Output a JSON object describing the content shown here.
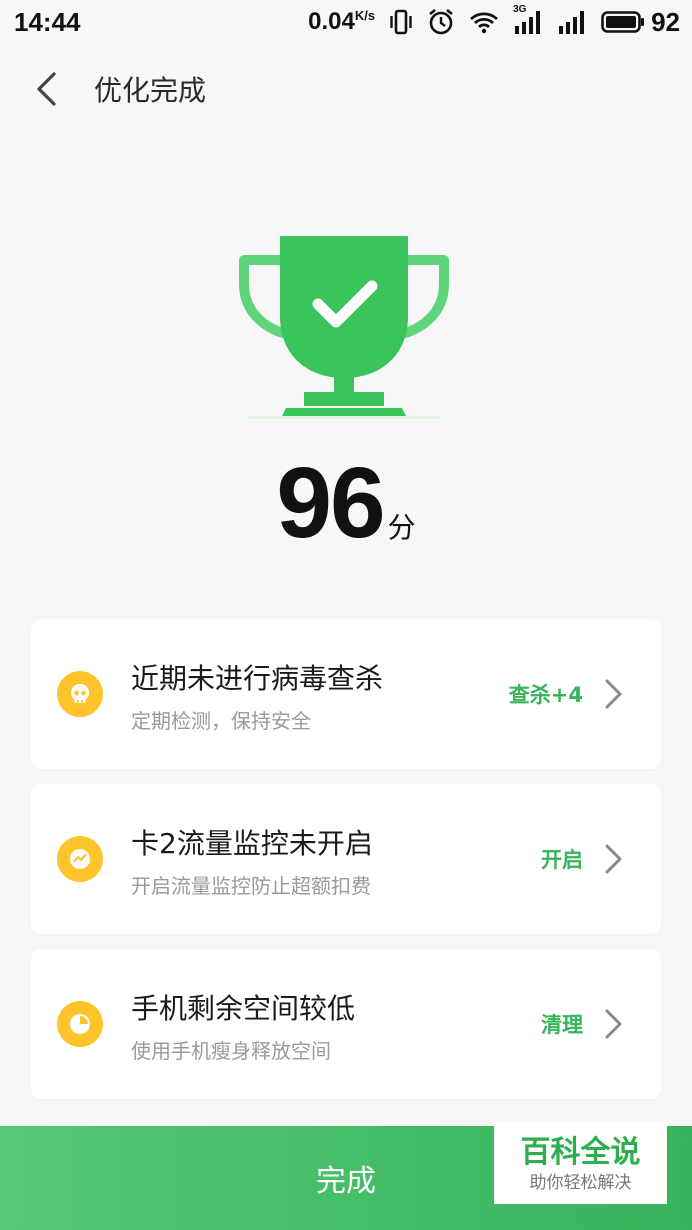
{
  "status": {
    "time": "14:44",
    "speed": "0.04",
    "speed_unit": "K/s",
    "battery": "92",
    "network": "3G"
  },
  "header": {
    "title": "优化完成"
  },
  "score": {
    "value": "96",
    "unit": "分"
  },
  "cards": [
    {
      "title": "近期未进行病毒查杀",
      "subtitle": "定期检测，保持安全",
      "action": "查杀+4",
      "icon": "skull-icon"
    },
    {
      "title": "卡2流量监控未开启",
      "subtitle": "开启流量监控防止超额扣费",
      "action": "开启",
      "icon": "traffic-monitor-icon"
    },
    {
      "title": "手机剩余空间较低",
      "subtitle": "使用手机瘦身释放空间",
      "action": "清理",
      "icon": "pie-chart-icon"
    }
  ],
  "done_button": {
    "label": "完成"
  },
  "watermark": {
    "title": "百科全说",
    "subtitle": "助你轻松解决"
  },
  "colors": {
    "accent": "#37b45a",
    "warning": "#ffc42c",
    "trophy": "#3cc45c"
  }
}
